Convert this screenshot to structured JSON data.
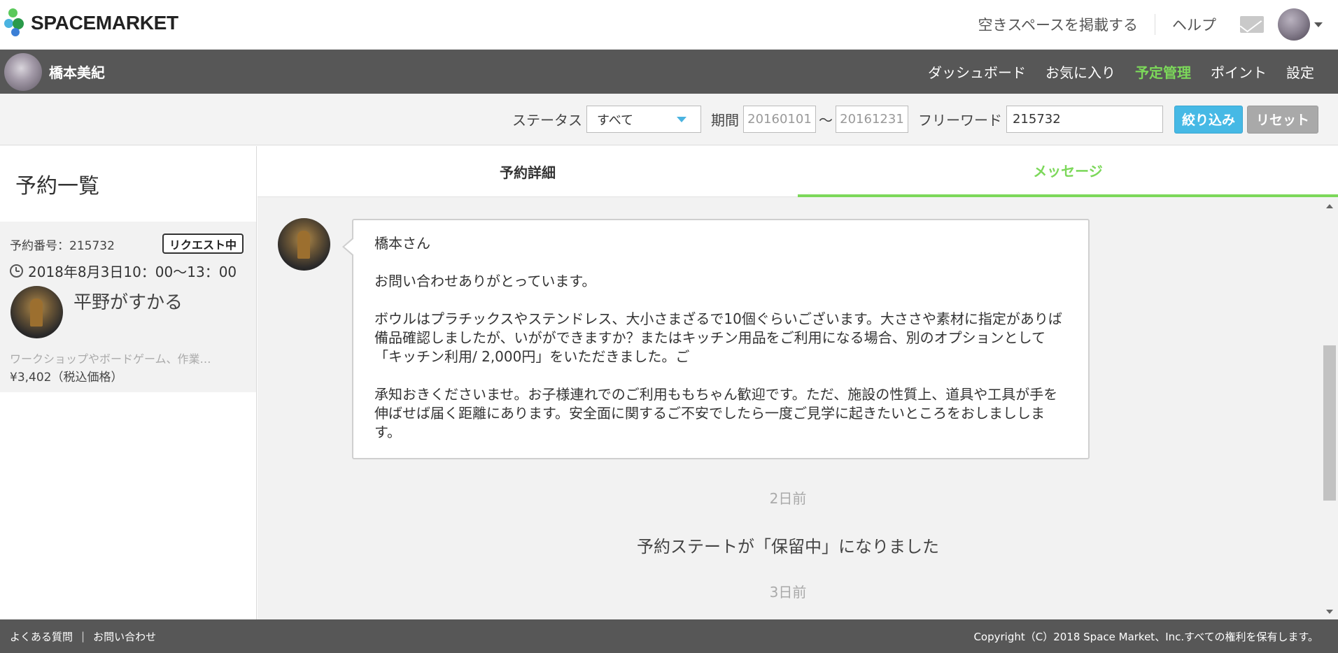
{
  "header": {
    "logo_text": "SPACEMARKET",
    "list_space_link": "空きスペースを掲載する",
    "help_link": "ヘルプ"
  },
  "userbar": {
    "user_name": "橋本美紀",
    "nav": [
      "ダッシュボード",
      "お気に入り",
      "予定管理",
      "ポイント",
      "設定"
    ],
    "active_nav": "予定管理"
  },
  "filter": {
    "status_label": "ステータス",
    "status_value": "すべて",
    "period_label": "期間",
    "date_from": "20160101",
    "tilde": "～",
    "date_to": "20161231",
    "keyword_label": "フリーワード",
    "keyword_value": "215732",
    "filter_button": "絞り込み",
    "reset_button": "リセット"
  },
  "sidebar": {
    "title": "予約一覧",
    "reservation": {
      "number": "予約番号：215732",
      "badge": "リクエスト中",
      "datetime": "2018年8月3日10：00～13：00",
      "host_name": "平野がすかる",
      "description": "ワークショップやボードゲーム、作業…",
      "price": "¥3,402（税込価格）"
    }
  },
  "main": {
    "tabs": [
      "予約詳細",
      "メッセージ"
    ],
    "active_tab": "メッセージ",
    "message": {
      "greeting": "橋本さん",
      "line1": "お問い合わせありがとっています。",
      "para1": "ボウルはプラチックスやステンドレス、大小さまざるで10個ぐらいございます。大ささや素材に指定がありば備品確認しましたが、いがができますか？またはキッチン用品をご利用になる場合、別のオプションとして「キッチン利用/ 2,000円」をいただきました。ご",
      "para2": "承知おきくださいませ。お子様連れでのご利用ももちゃん歓迎です。ただ、施設の性質上、道具や工具が手を伸ばせば届く距離にあります。安全面に関するご不安でしたら一度ご見学に起きたいところをおしましします。"
    },
    "timestamp1": "2日前",
    "status_change": "予約ステートが「保留中」になりました",
    "timestamp2": "3日前"
  },
  "footer": {
    "faq": "よくある質問",
    "separator": "|",
    "contact": "お問い合わせ",
    "copyright": "Copyright（C）2018 Space Market、Inc.すべての権利を保有します。"
  },
  "colors": {
    "accent_green": "#7cd85a",
    "filter_button": "#46b9e5",
    "dark_bar": "#575757"
  },
  "icons": [
    "logo-icon",
    "mail-icon",
    "user-avatar",
    "chevron-down-icon",
    "dropdown-arrow-icon",
    "clock-icon",
    "scroll-up-icon",
    "scroll-down-icon"
  ]
}
